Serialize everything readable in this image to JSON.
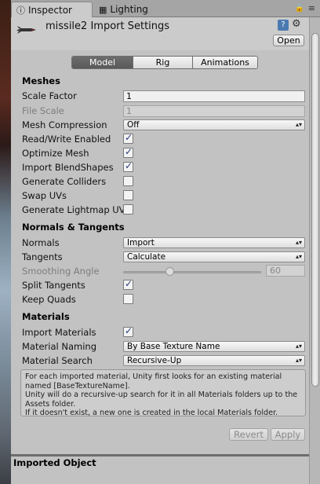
{
  "tabs": [
    {
      "label": "Inspector",
      "icon": "info-icon"
    },
    {
      "label": "Lighting",
      "icon": "grid-icon"
    }
  ],
  "header": {
    "title": "missile2 Import Settings",
    "open_label": "Open"
  },
  "segmented": [
    "Model",
    "Rig",
    "Animations"
  ],
  "meshes": {
    "section": "Meshes",
    "scale_factor_label": "Scale Factor",
    "scale_factor_value": "1",
    "file_scale_label": "File Scale",
    "file_scale_value": "1",
    "mesh_compression_label": "Mesh Compression",
    "mesh_compression_value": "Off",
    "read_write_label": "Read/Write Enabled",
    "read_write_checked": true,
    "optimize_mesh_label": "Optimize Mesh",
    "optimize_mesh_checked": true,
    "import_blendshapes_label": "Import BlendShapes",
    "import_blendshapes_checked": true,
    "generate_colliders_label": "Generate Colliders",
    "generate_colliders_checked": false,
    "swap_uvs_label": "Swap UVs",
    "swap_uvs_checked": false,
    "generate_lightmap_label": "Generate Lightmap UV",
    "generate_lightmap_checked": false
  },
  "normals": {
    "section": "Normals & Tangents",
    "normals_label": "Normals",
    "normals_value": "Import",
    "tangents_label": "Tangents",
    "tangents_value": "Calculate",
    "smoothing_label": "Smoothing Angle",
    "smoothing_value": "60",
    "split_tangents_label": "Split Tangents",
    "split_tangents_checked": true,
    "keep_quads_label": "Keep Quads",
    "keep_quads_checked": false
  },
  "materials": {
    "section": "Materials",
    "import_materials_label": "Import Materials",
    "import_materials_checked": true,
    "naming_label": "Material Naming",
    "naming_value": "By Base Texture Name",
    "search_label": "Material Search",
    "search_value": "Recursive-Up",
    "help_lines": [
      "For each imported material, Unity first looks for an existing material named [BaseTextureName].",
      "Unity will do a recursive-up search for it in all Materials folders up to the Assets folder.",
      "If it doesn't exist, a new one is created in the local Materials folder."
    ]
  },
  "buttons": {
    "revert": "Revert",
    "apply": "Apply"
  },
  "bottom_section": "Imported Object"
}
